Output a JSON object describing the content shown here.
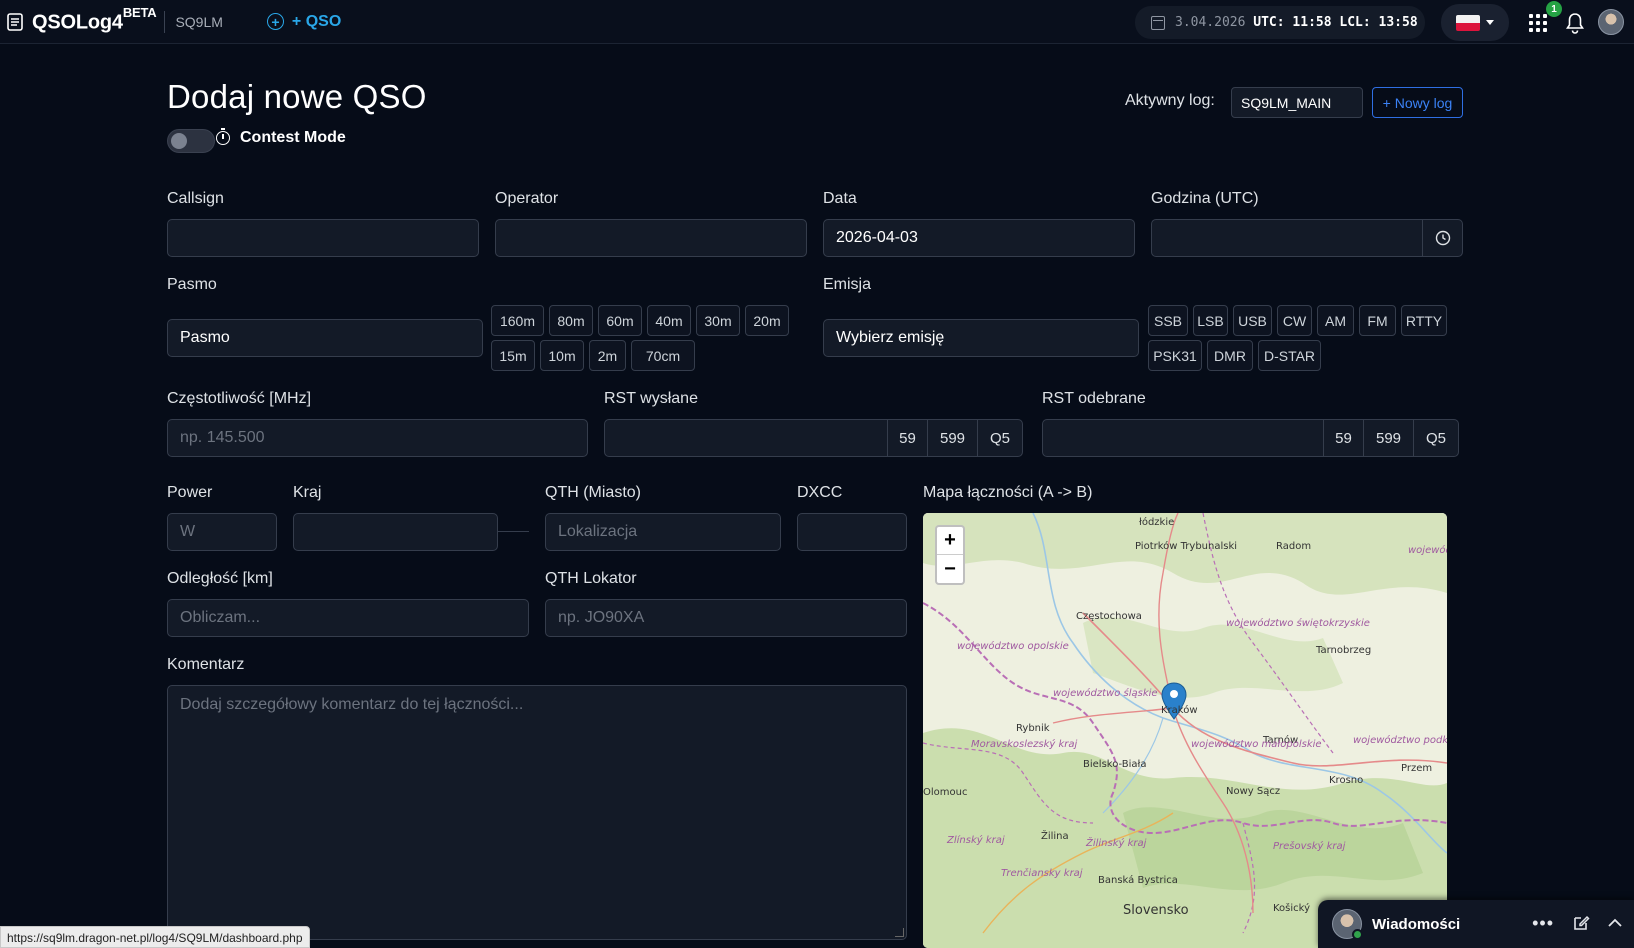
{
  "navbar": {
    "brand": "QSOLog4",
    "brand_sup": "BETA",
    "callsign": "SQ9LM",
    "add_qso": "+ QSO",
    "date": "3.04.2026",
    "utc_label": "UTC:",
    "utc_time": "11:58",
    "lcl_label": "LCL:",
    "lcl_time": "13:58",
    "notifications_badge": "1",
    "flag": "PL"
  },
  "page": {
    "title": "Dodaj nowe QSO",
    "contest_mode": "Contest Mode",
    "contest_mode_on": false,
    "active_log_label": "Aktywny log:",
    "active_log_value": "SQ9LM_MAIN",
    "new_log_button": "+ Nowy log"
  },
  "form": {
    "callsign_label": "Callsign",
    "callsign_value": "",
    "operator_label": "Operator",
    "operator_value": "",
    "date_label": "Data",
    "date_value": "2026-04-03",
    "time_label": "Godzina (UTC)",
    "time_value": "",
    "band_label": "Pasmo",
    "band_select": "Pasmo",
    "bands_row1": [
      "160m",
      "80m",
      "60m",
      "40m",
      "30m",
      "20m"
    ],
    "bands_row2": [
      "15m",
      "10m",
      "2m",
      "70cm"
    ],
    "mode_label": "Emisja",
    "mode_select": "Wybierz emisję",
    "modes_row1": [
      "SSB",
      "LSB",
      "USB",
      "CW",
      "AM",
      "FM",
      "RTTY"
    ],
    "modes_row2": [
      "PSK31",
      "DMR",
      "D-STAR"
    ],
    "freq_label": "Częstotliwość [MHz]",
    "freq_placeholder": "np. 145.500",
    "rst_sent_label": "RST wysłane",
    "rst_recv_label": "RST odebrane",
    "rst_buttons": [
      "59",
      "599",
      "Q5"
    ],
    "power_label": "Power",
    "power_placeholder": "W",
    "country_label": "Kraj",
    "qth_city_label": "QTH (Miasto)",
    "qth_city_placeholder": "Lokalizacja",
    "dxcc_label": "DXCC",
    "distance_label": "Odległość [km]",
    "distance_placeholder": "Obliczam...",
    "locator_label": "QTH Lokator",
    "locator_placeholder": "np. JO90XA",
    "comment_label": "Komentarz",
    "comment_placeholder": "Dodaj szczegółowy komentarz do tej łączności...",
    "map_label": "Mapa łączności (A -> B)"
  },
  "map": {
    "zoom_in": "+",
    "zoom_out": "−",
    "places": [
      "łódzkie",
      "Piotrków Trybunalski",
      "Radom",
      "województwo lubelskie",
      "Częstochowa",
      "województwo świętokrzyskie",
      "Tarnobrzeg",
      "województwo opolskie",
      "województwo śląskie",
      "Kraków",
      "Rybnik",
      "Tarnów",
      "województwo podkarpackie",
      "Moravskoslezský kraj",
      "Bielsko-Biała",
      "województwo małopolskie",
      "Krosno",
      "Przem",
      "Olomouc",
      "Nowy Sącz",
      "Žilina",
      "Žilinský kraj",
      "Zlínský kraj",
      "Prešovský kraj",
      "Trenčiansky kraj",
      "Banská Bystrica",
      "Slovensko",
      "Košický"
    ]
  },
  "statusbar": "https://sq9lm.dragon-net.pl/log4/SQ9LM/dashboard.php",
  "messages": {
    "title": "Wiadomości"
  }
}
